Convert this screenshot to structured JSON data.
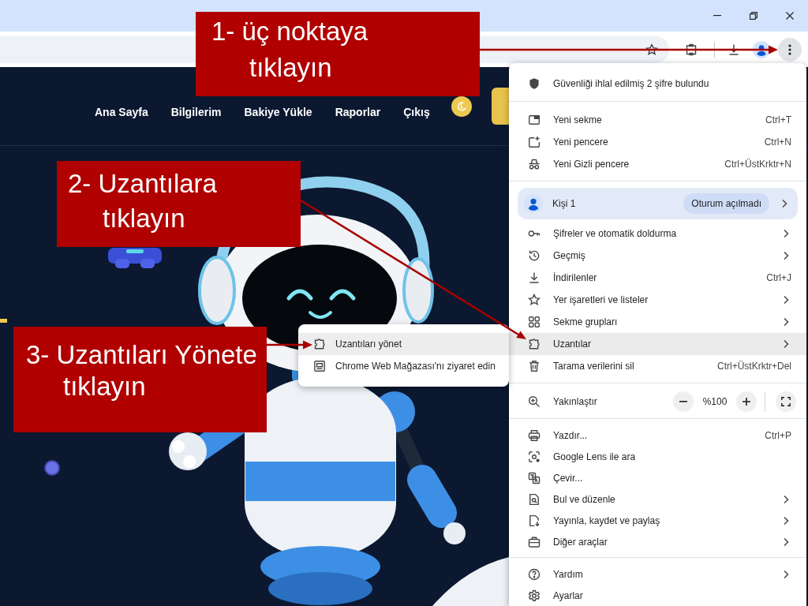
{
  "annotations": [
    {
      "text": "1- üç noktaya tıklayın"
    },
    {
      "text": "2- Uzantılara tıklayın"
    },
    {
      "text": "3- Uzantıları Yönete tıklayın"
    }
  ],
  "site": {
    "nav": [
      "Ana Sayfa",
      "Bilgilerim",
      "Bakiye Yükle",
      "Raporlar",
      "Çıkış"
    ]
  },
  "chrome_menu": {
    "sections": [
      {
        "items": [
          {
            "kind": "item",
            "label": "Güvenliği ihlal edilmiş 2 şifre bulundu",
            "submenu": false,
            "selected": false
          }
        ]
      },
      {
        "items": [
          {
            "kind": "item",
            "label": "Yeni sekme",
            "shortcut": "Ctrl+T",
            "submenu": false,
            "selected": false
          },
          {
            "kind": "item",
            "label": "Yeni pencere",
            "shortcut": "Ctrl+N",
            "submenu": false,
            "selected": false
          },
          {
            "kind": "item",
            "label": "Yeni Gizli pencere",
            "shortcut": "Ctrl+ÜstKrktr+N",
            "submenu": false,
            "selected": false
          }
        ]
      },
      {
        "items": [
          {
            "kind": "profile",
            "label": "Kişi 1",
            "status": "Oturum açılmadı",
            "submenu": true,
            "selected": false
          },
          {
            "kind": "item",
            "label": "Şifreler ve otomatik doldurma",
            "submenu": true,
            "selected": false
          },
          {
            "kind": "item",
            "label": "Geçmiş",
            "submenu": true,
            "selected": false
          },
          {
            "kind": "item",
            "label": "İndirilenler",
            "shortcut": "Ctrl+J",
            "submenu": false,
            "selected": false
          },
          {
            "kind": "item",
            "label": "Yer işaretleri ve listeler",
            "submenu": true,
            "selected": false
          },
          {
            "kind": "item",
            "label": "Sekme grupları",
            "submenu": true,
            "selected": false
          },
          {
            "kind": "item",
            "label": "Uzantılar",
            "submenu": true,
            "selected": true
          },
          {
            "kind": "item",
            "label": "Tarama verilerini sil",
            "shortcut": "Ctrl+ÜstKrktr+Del",
            "submenu": false,
            "selected": false
          }
        ]
      },
      {
        "items": [
          {
            "kind": "zoom",
            "label": "Yakınlaştır",
            "value": "%100"
          }
        ]
      },
      {
        "items": [
          {
            "kind": "item",
            "label": "Yazdır...",
            "shortcut": "Ctrl+P",
            "submenu": false,
            "selected": false
          },
          {
            "kind": "item",
            "label": "Google Lens ile ara",
            "submenu": false,
            "selected": false
          },
          {
            "kind": "item",
            "label": "Çevir...",
            "submenu": false,
            "selected": false
          },
          {
            "kind": "item",
            "label": "Bul ve düzenle",
            "submenu": true,
            "selected": false
          },
          {
            "kind": "item",
            "label": "Yayınla, kaydet ve paylaş",
            "submenu": true,
            "selected": false
          },
          {
            "kind": "item",
            "label": "Diğer araçlar",
            "submenu": true,
            "selected": false
          }
        ]
      },
      {
        "items": [
          {
            "kind": "item",
            "label": "Yardım",
            "submenu": true,
            "selected": false
          },
          {
            "kind": "item",
            "label": "Ayarlar",
            "submenu": false,
            "selected": false
          }
        ]
      }
    ]
  },
  "extensions_submenu": {
    "items": [
      {
        "label": "Uzantıları yönet",
        "selected": true
      },
      {
        "label": "Chrome Web Mağazası'nı ziyaret edin",
        "selected": false
      }
    ]
  }
}
